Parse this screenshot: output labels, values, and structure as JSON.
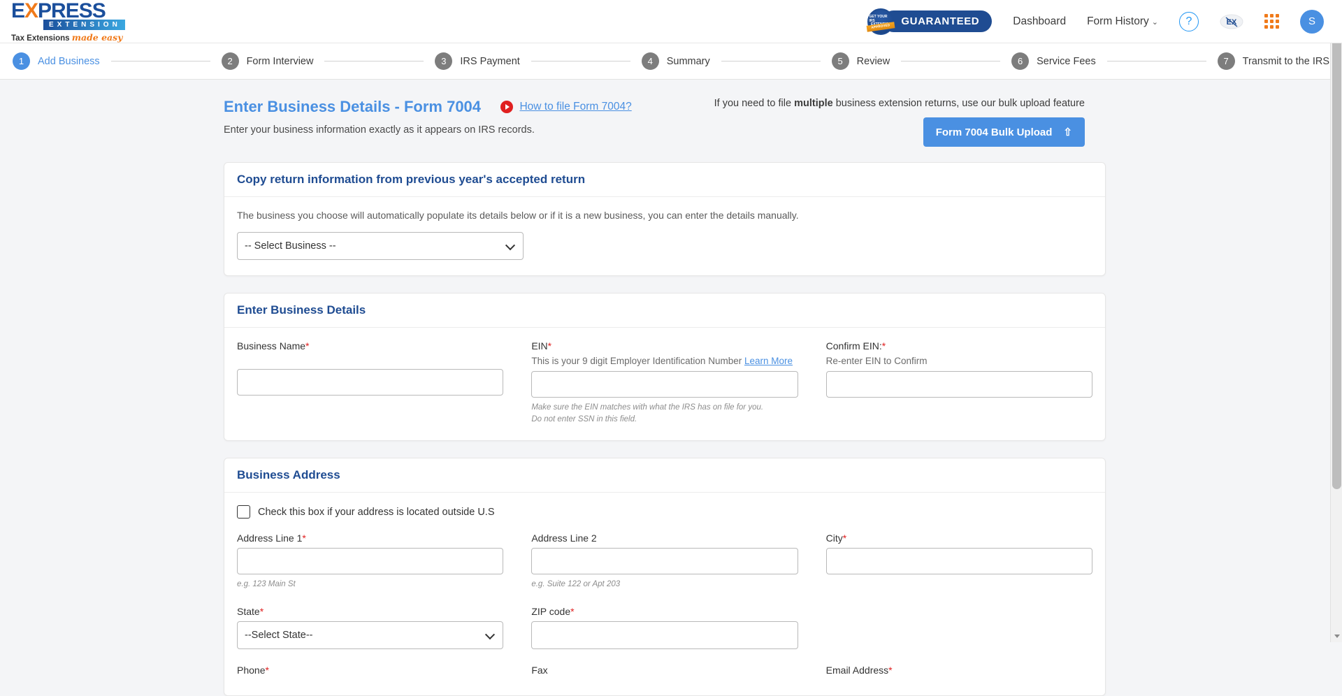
{
  "brand": {
    "logo_express": "EXPRESS",
    "logo_x": "X",
    "logo_extension": "EXTENSION",
    "tagline_bold": "Tax Extensions",
    "tagline_italic": "made easy"
  },
  "topbar": {
    "guaranteed_label": "GUARANTEED",
    "seal_top": "GET YOUR IRS",
    "seal_mid": "EXTENSION",
    "seal_band": "APPROVED",
    "dashboard_label": "Dashboard",
    "form_history_label": "Form History",
    "caret": "⌄",
    "help_glyph": "?",
    "chat_label": "EX",
    "avatar_initial": "S"
  },
  "stepper": {
    "steps": [
      {
        "num": "1",
        "label": "Add Business",
        "active": true
      },
      {
        "num": "2",
        "label": "Form Interview",
        "active": false
      },
      {
        "num": "3",
        "label": "IRS Payment",
        "active": false
      },
      {
        "num": "4",
        "label": "Summary",
        "active": false
      },
      {
        "num": "5",
        "label": "Review",
        "active": false
      },
      {
        "num": "6",
        "label": "Service Fees",
        "active": false
      },
      {
        "num": "7",
        "label": "Transmit to the IRS",
        "active": false
      }
    ]
  },
  "page": {
    "title": "Enter Business Details - Form 7004",
    "howto_link": "How to file Form 7004?",
    "subtitle": "Enter your business information exactly as it appears on IRS records.",
    "bulk_note_pre": "If you need to file ",
    "bulk_note_bold": "multiple",
    "bulk_note_post": " business extension returns, use our bulk upload feature",
    "bulk_button": "Form 7004 Bulk Upload",
    "upload_glyph": "⇧"
  },
  "copy_panel": {
    "heading": "Copy return information from previous year's accepted return",
    "helper": "The business you choose will automatically populate its details below or if it is a new business, you can enter the details manually.",
    "select_value": "-- Select Business --",
    "select_options": [
      "-- Select Business --"
    ]
  },
  "business_details": {
    "heading": "Enter Business Details",
    "business_name_label": "Business Name",
    "ein_label": "EIN",
    "ein_sub": "This is your 9 digit Employer Identification Number",
    "ein_learn_more": "Learn More",
    "ein_hint_line1": "Make sure the EIN matches with what the IRS has on file for you.",
    "ein_hint_line2": "Do not enter SSN in this field.",
    "confirm_ein_label": "Confirm EIN:",
    "confirm_ein_sub": "Re-enter EIN to Confirm",
    "business_name_value": "",
    "ein_value": "",
    "confirm_ein_value": "",
    "required_mark": "*"
  },
  "business_address": {
    "heading": "Business Address",
    "outside_us_label": "Check this box if your address is located outside U.S",
    "outside_us_checked": false,
    "address1_label": "Address Line 1",
    "address1_hint": "e.g. 123 Main St",
    "address1_value": "",
    "address2_label": "Address Line 2",
    "address2_hint": "e.g. Suite 122 or Apt 203",
    "address2_value": "",
    "city_label": "City",
    "city_value": "",
    "state_label": "State",
    "state_value": "--Select State--",
    "state_options": [
      "--Select State--"
    ],
    "zip_label": "ZIP code",
    "zip_value": "",
    "phone_label": "Phone",
    "fax_label": "Fax",
    "email_label": "Email Address",
    "required_mark": "*"
  },
  "colors": {
    "accent_blue": "#4a90e2",
    "heading_blue": "#1f4c92",
    "required_red": "#e02020",
    "orange": "#f07a1a",
    "page_bg": "#f4f5f7"
  }
}
